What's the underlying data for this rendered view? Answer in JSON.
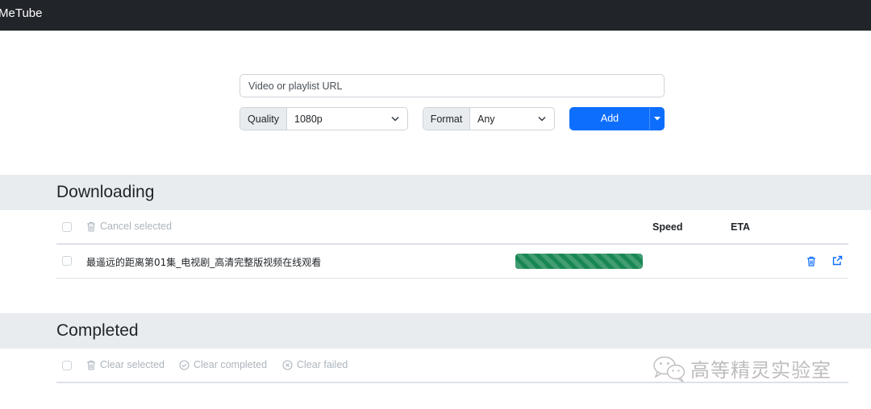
{
  "navbar": {
    "brand": "MeTube"
  },
  "form": {
    "url_placeholder": "Video or playlist URL",
    "quality": {
      "label": "Quality",
      "selected": "1080p"
    },
    "format": {
      "label": "Format",
      "selected": "Any"
    },
    "add_label": "Add"
  },
  "downloading": {
    "title": "Downloading",
    "cancel_selected": "Cancel selected",
    "columns": {
      "speed": "Speed",
      "eta": "ETA"
    },
    "items": [
      {
        "title": "最遥远的距离第01集_电视剧_高清完整版视频在线观看",
        "progress": 1.0,
        "speed": "",
        "eta": ""
      }
    ]
  },
  "completed": {
    "title": "Completed",
    "clear_selected": "Clear selected",
    "clear_completed": "Clear completed",
    "clear_failed": "Clear failed"
  },
  "watermark": {
    "text": "高等精灵实验室"
  },
  "colors": {
    "navbar": "#212529",
    "primary": "#0d6efd",
    "progress": "#198754",
    "section_bg": "#e9ecef"
  }
}
